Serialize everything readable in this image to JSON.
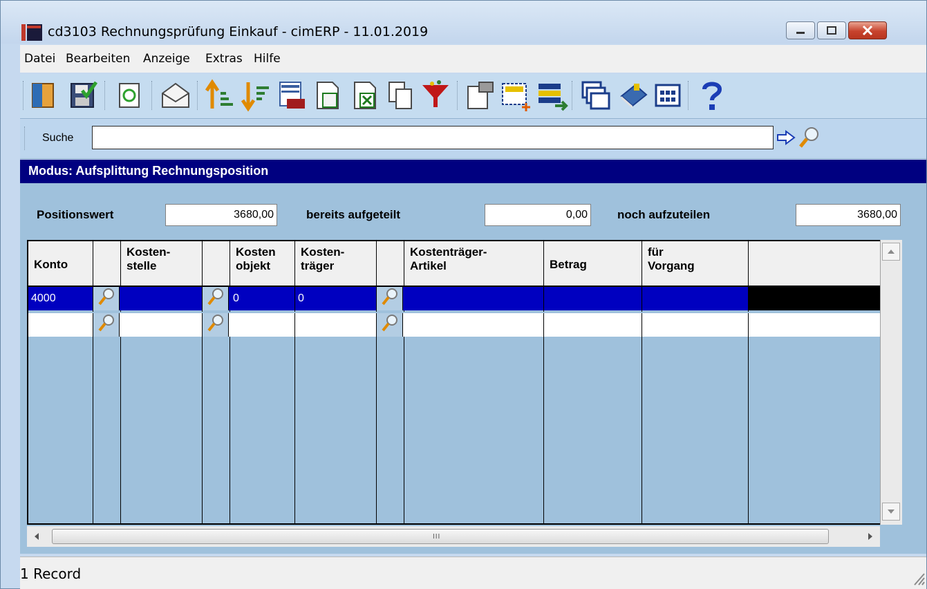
{
  "window": {
    "title": "cd3103 Rechnungsprüfung Einkauf - cimERP - 11.01.2019",
    "controls": [
      "minimize",
      "maximize",
      "close"
    ]
  },
  "menu": {
    "items": [
      "Datei",
      "Bearbeiten",
      "Anzeige",
      "Extras",
      "Hilfe"
    ]
  },
  "toolbar": {
    "icons": [
      "exit-icon",
      "save-icon",
      "refresh-icon",
      "mail-icon",
      "sort-ascending-icon",
      "sort-descending-icon",
      "calendar-icon",
      "export-icon",
      "excel-icon",
      "copy-icon",
      "filter-icon",
      "properties-icon",
      "new-record-icon",
      "form-icon",
      "windows-icon",
      "book-icon",
      "grid-icon",
      "help-icon"
    ]
  },
  "search": {
    "label": "Suche",
    "value": "",
    "icons": [
      "arrow-right-icon",
      "search-icon"
    ]
  },
  "mode": {
    "text": "Modus: Aufsplittung Rechnungsposition"
  },
  "summary": {
    "positionswert_label": "Positionswert",
    "positionswert_value": "3680,00",
    "aufgeteilt_label": "bereits aufgeteilt",
    "aufgeteilt_value": "0,00",
    "aufzuteilen_label": "noch aufzuteilen",
    "aufzuteilen_value": "3680,00"
  },
  "grid": {
    "headers": {
      "konto": "Konto",
      "kostenstelle": "Kosten-\nstelle",
      "kostenobjekt": "Kosten\nobjekt",
      "kostentraeger": "Kosten-\nträger",
      "artikel": "Kostenträger-\nArtikel",
      "betrag": "Betrag",
      "vorgang": "für\nVorgang"
    },
    "rows": [
      {
        "konto": "4000",
        "kostenstelle": "",
        "kostenobjekt": "0",
        "kostentraeger": "0",
        "artikel": "",
        "betrag": "",
        "vorgang": ""
      },
      {
        "konto": "",
        "kostenstelle": "",
        "kostenobjekt": "",
        "kostentraeger": "",
        "artikel": "",
        "betrag": "",
        "vorgang": ""
      }
    ],
    "hscroll_grip": "III"
  },
  "status": {
    "text": "1 Record"
  }
}
